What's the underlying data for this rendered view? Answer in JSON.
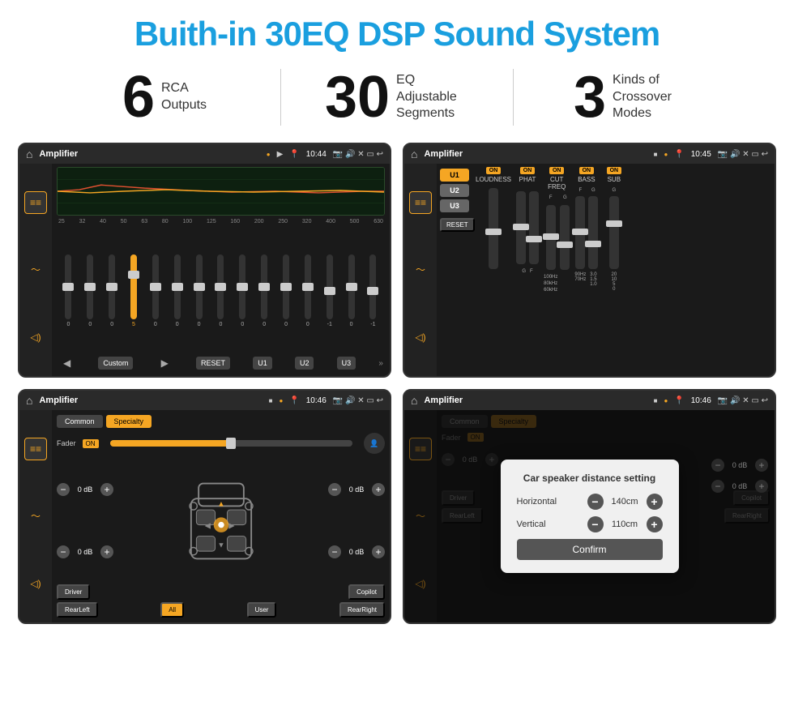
{
  "page": {
    "title": "Buith-in 30EQ DSP Sound System"
  },
  "stats": [
    {
      "number": "6",
      "desc_line1": "RCA",
      "desc_line2": "Outputs"
    },
    {
      "number": "30",
      "desc_line1": "EQ Adjustable",
      "desc_line2": "Segments"
    },
    {
      "number": "3",
      "desc_line1": "Kinds of",
      "desc_line2": "Crossover Modes"
    }
  ],
  "screens": [
    {
      "id": "screen1",
      "topbar": {
        "time": "10:44",
        "title": "Amplifier"
      },
      "eq_labels": [
        "25",
        "32",
        "40",
        "50",
        "63",
        "80",
        "100",
        "125",
        "160",
        "200",
        "250",
        "320",
        "400",
        "500",
        "630"
      ],
      "eq_values": [
        "0",
        "0",
        "0",
        "5",
        "0",
        "0",
        "0",
        "0",
        "0",
        "0",
        "0",
        "0",
        "-1",
        "0",
        "-1"
      ],
      "eq_mode": "Custom",
      "buttons": [
        "RESET",
        "U1",
        "U2",
        "U3"
      ]
    },
    {
      "id": "screen2",
      "topbar": {
        "time": "10:45",
        "title": "Amplifier"
      },
      "presets": [
        "U1",
        "U2",
        "U3"
      ],
      "sections": [
        "LOUDNESS",
        "PHAT",
        "CUT FREQ",
        "BASS",
        "SUB"
      ],
      "freq_labels": [
        "3.0",
        "100Hz",
        "90Hz",
        "3.0",
        "20"
      ],
      "reset_label": "RESET"
    },
    {
      "id": "screen3",
      "topbar": {
        "time": "10:46",
        "title": "Amplifier"
      },
      "tabs": [
        "Common",
        "Specialty"
      ],
      "fader_label": "Fader",
      "fader_on": "ON",
      "volumes": [
        "0 dB",
        "0 dB",
        "0 dB",
        "0 dB"
      ],
      "buttons": [
        "Driver",
        "Copilot",
        "RearLeft",
        "All",
        "User",
        "RearRight"
      ]
    },
    {
      "id": "screen4",
      "topbar": {
        "time": "10:46",
        "title": "Amplifier"
      },
      "tabs": [
        "Common",
        "Specialty"
      ],
      "fader_on": "ON",
      "dialog": {
        "title": "Car speaker distance setting",
        "horizontal_label": "Horizontal",
        "horizontal_value": "140cm",
        "vertical_label": "Vertical",
        "vertical_value": "110cm",
        "confirm_label": "Confirm",
        "side_volumes": [
          "0 dB",
          "0 dB"
        ]
      }
    }
  ]
}
